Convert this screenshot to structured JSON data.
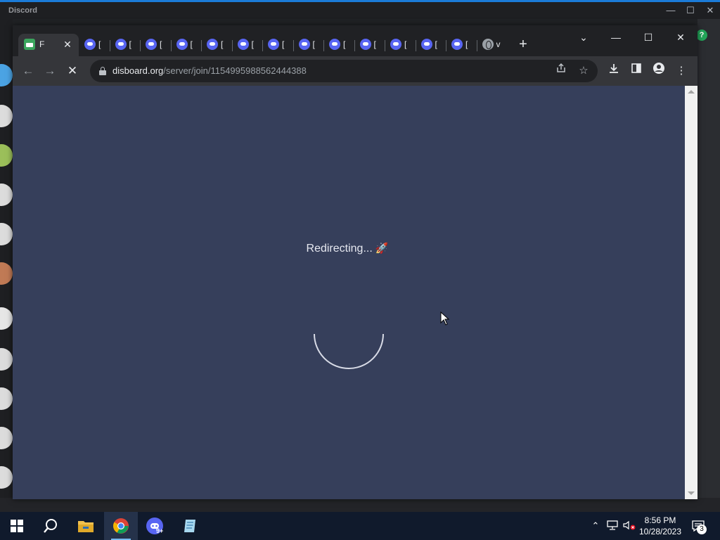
{
  "discord": {
    "app_name": "Discord",
    "help_icon": "question-icon",
    "controls": {
      "minimize": "—",
      "maximize": "☐",
      "close": "✕"
    }
  },
  "browser": {
    "tabs": [
      {
        "icon": "disboard-favicon",
        "title": "F",
        "active": true
      },
      {
        "icon": "discord-favicon",
        "title": "["
      },
      {
        "icon": "discord-favicon",
        "title": "["
      },
      {
        "icon": "discord-favicon",
        "title": "["
      },
      {
        "icon": "discord-favicon",
        "title": "["
      },
      {
        "icon": "discord-favicon",
        "title": "["
      },
      {
        "icon": "discord-favicon",
        "title": "["
      },
      {
        "icon": "discord-favicon",
        "title": "["
      },
      {
        "icon": "discord-favicon",
        "title": "["
      },
      {
        "icon": "discord-favicon",
        "title": "["
      },
      {
        "icon": "discord-favicon",
        "title": "["
      },
      {
        "icon": "discord-favicon",
        "title": "["
      },
      {
        "icon": "discord-favicon",
        "title": "["
      },
      {
        "icon": "discord-favicon",
        "title": "["
      },
      {
        "icon": "globe-favicon",
        "title": "v"
      }
    ],
    "address": {
      "host": "disboard.org",
      "path": "/server/join/1154995988562444388"
    },
    "loading": true
  },
  "page": {
    "status_text": "Redirecting...",
    "emoji": "🚀"
  },
  "taskbar": {
    "apps": [
      "start",
      "search",
      "file-explorer",
      "chrome",
      "discord",
      "notepad"
    ],
    "discord_badge": "9+",
    "clock_time": "8:56 PM",
    "clock_date": "10/28/2023",
    "notifications_count": "3"
  },
  "colors": {
    "page_background": "#363f5b",
    "browser_frame": "#202124",
    "toolbar": "#35363a",
    "taskbar": "#101a2c"
  }
}
